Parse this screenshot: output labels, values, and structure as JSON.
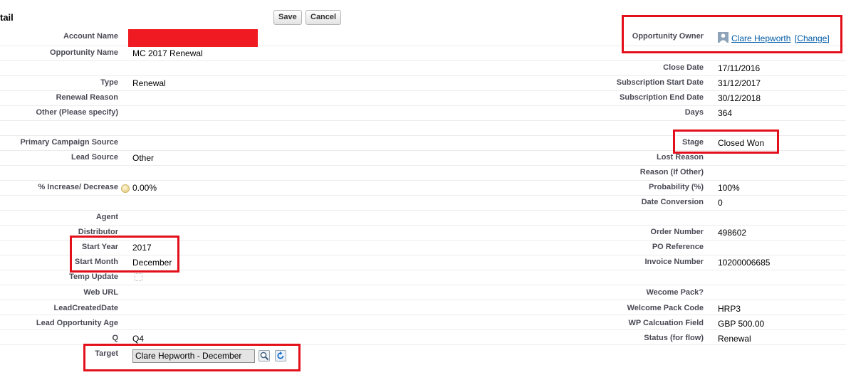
{
  "header": {
    "title": "tail",
    "save_label": "Save",
    "cancel_label": "Cancel"
  },
  "left_fields": [
    {
      "label": "Account Name",
      "value": ""
    },
    {
      "label": "Opportunity Name",
      "value": "MC 2017 Renewal"
    },
    {
      "label": "Type",
      "value": "Renewal"
    },
    {
      "label": "Renewal Reason",
      "value": ""
    },
    {
      "label": "Other (Please specify)",
      "value": ""
    },
    {
      "label": "Primary Campaign Source",
      "value": ""
    },
    {
      "label": "Lead Source",
      "value": "Other"
    },
    {
      "label": "% Increase/ Decrease",
      "value": "0.00%"
    },
    {
      "label": "Agent",
      "value": ""
    },
    {
      "label": "Distributor",
      "value": ""
    },
    {
      "label": "Start Year",
      "value": "2017"
    },
    {
      "label": "Start Month",
      "value": "December"
    },
    {
      "label": "Temp Update",
      "value": ""
    },
    {
      "label": "Web URL",
      "value": ""
    },
    {
      "label": "LeadCreatedDate",
      "value": ""
    },
    {
      "label": "Lead Opportunity Age",
      "value": ""
    },
    {
      "label": "Q",
      "value": "Q4"
    },
    {
      "label": "Target",
      "value": "Clare Hepworth - December"
    }
  ],
  "owner": {
    "label": "Opportunity Owner",
    "name": "Clare Hepworth",
    "change_label": "[Change]",
    "icon": "user-avatar-icon"
  },
  "right_fields": [
    {
      "label": "Close Date",
      "value": "17/11/2016"
    },
    {
      "label": "Subscription Start Date",
      "value": "31/12/2017"
    },
    {
      "label": "Subscription End Date",
      "value": "30/12/2018"
    },
    {
      "label": "Days",
      "value": "364"
    },
    {
      "label": "Stage",
      "value": "Closed Won"
    },
    {
      "label": "Lost Reason",
      "value": ""
    },
    {
      "label": "Reason (If Other)",
      "value": ""
    },
    {
      "label": "Probability (%)",
      "value": "100%"
    },
    {
      "label": "Date Conversion",
      "value": "0"
    },
    {
      "label": "Order Number",
      "value": "498602"
    },
    {
      "label": "PO Reference",
      "value": ""
    },
    {
      "label": "Invoice Number",
      "value": "10200006685"
    },
    {
      "label": "Wecome Pack?",
      "value": ""
    },
    {
      "label": "Welcome Pack Code",
      "value": "HRP3"
    },
    {
      "label": "WP Calcuation Field",
      "value": "GBP 500.00"
    },
    {
      "label": "Status (for flow)",
      "value": "Renewal"
    }
  ],
  "icons": {
    "help": "help-icon",
    "lookup": "lookup-magnifier-icon",
    "refresh": "refresh-icon",
    "checkbox": "checkbox"
  },
  "colors": {
    "highlight": "#e3101b",
    "redaction": "#ef1a22",
    "link": "#015ba7"
  }
}
